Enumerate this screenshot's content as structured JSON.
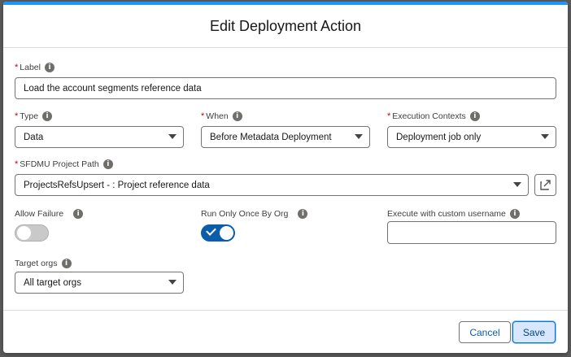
{
  "modal": {
    "title": "Edit Deployment Action",
    "required_mark": "*",
    "info_glyph": "i"
  },
  "label_field": {
    "label": "Label",
    "value": "Load the account segments reference data"
  },
  "type_field": {
    "label": "Type",
    "value": "Data"
  },
  "when_field": {
    "label": "When",
    "value": "Before Metadata Deployment"
  },
  "execution_contexts_field": {
    "label": "Execution Contexts",
    "value": "Deployment job only"
  },
  "sfdmu_field": {
    "label": "SFDMU Project Path",
    "value": "ProjectsRefsUpsert - : Project reference data",
    "external_link_icon": "new-window-icon"
  },
  "allow_failure": {
    "label": "Allow Failure",
    "checked": false
  },
  "run_only_once": {
    "label": "Run Only Once By Org",
    "checked": true
  },
  "custom_username": {
    "label": "Execute with custom username",
    "value": ""
  },
  "target_orgs": {
    "label": "Target orgs",
    "value": "All target orgs"
  },
  "footer": {
    "cancel_label": "Cancel",
    "save_label": "Save"
  },
  "colors": {
    "accent": "#1b96ff",
    "brand_blue": "#0b5cab",
    "required_red": "#ba0517"
  }
}
